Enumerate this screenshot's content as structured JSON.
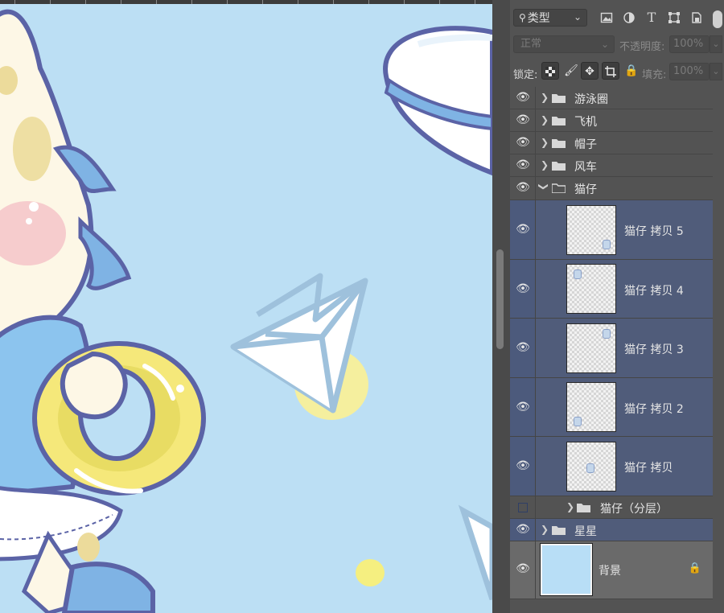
{
  "colors": {
    "canvas_bg": "#bcdff4",
    "panel_bg": "#535353",
    "selected_layer": "#505c7a",
    "outline": "#5b63a6",
    "ring_yellow": "#f5e87a"
  },
  "filter": {
    "kind_label": "类型",
    "search_icon": "search-icon",
    "icons": [
      "image-filter-icon",
      "adjustment-filter-icon",
      "type-filter-icon",
      "shape-filter-icon",
      "smart-object-filter-icon"
    ]
  },
  "blend": {
    "mode": "正常",
    "opacity_label": "不透明度:",
    "opacity_value": "100%"
  },
  "lock": {
    "label": "锁定:",
    "fill_label": "填充:",
    "fill_value": "100%"
  },
  "layers": [
    {
      "name": "游泳圈",
      "type": "group",
      "visible": true,
      "expanded": false
    },
    {
      "name": "飞机",
      "type": "group",
      "visible": true,
      "expanded": false
    },
    {
      "name": "帽子",
      "type": "group",
      "visible": true,
      "expanded": false
    },
    {
      "name": "风车",
      "type": "group",
      "visible": true,
      "expanded": false
    },
    {
      "name": "猫仔",
      "type": "group",
      "visible": true,
      "expanded": true
    },
    {
      "name": "猫仔 拷贝 5",
      "type": "layer",
      "visible": true,
      "selected": true
    },
    {
      "name": "猫仔 拷贝 4",
      "type": "layer",
      "visible": true,
      "selected": true
    },
    {
      "name": "猫仔 拷贝 3",
      "type": "layer",
      "visible": true,
      "selected": true
    },
    {
      "name": "猫仔 拷贝 2",
      "type": "layer",
      "visible": true,
      "selected": true
    },
    {
      "name": "猫仔 拷贝",
      "type": "layer",
      "visible": true,
      "selected": true
    },
    {
      "name": "猫仔（分层）",
      "type": "group",
      "visible": false,
      "expanded": false
    },
    {
      "name": "星星",
      "type": "group",
      "visible": true,
      "expanded": false,
      "selected": true
    },
    {
      "name": "背景",
      "type": "background",
      "visible": true,
      "locked": true
    }
  ]
}
